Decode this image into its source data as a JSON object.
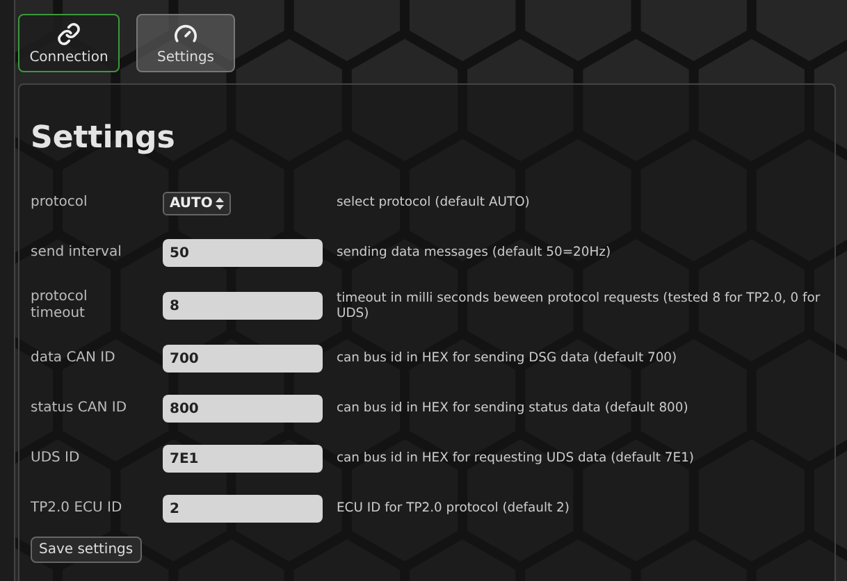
{
  "tabs": [
    {
      "label": "Connection",
      "selected": true
    },
    {
      "label": "Settings",
      "selected": false
    }
  ],
  "panel": {
    "title": "Settings",
    "fields": [
      {
        "kind": "select",
        "label": "protocol",
        "value": "AUTO",
        "description": "select protocol (default AUTO)"
      },
      {
        "kind": "input",
        "label": "send interval",
        "value": "50",
        "description": "sending data messages (default 50=20Hz)"
      },
      {
        "kind": "input",
        "label": "protocol timeout",
        "value": "8",
        "description": "timeout in milli seconds beween protocol requests (tested 8 for TP2.0, 0 for UDS)"
      },
      {
        "kind": "input",
        "label": "data CAN ID",
        "value": "700",
        "description": "can bus id in HEX for sending DSG data (default 700)"
      },
      {
        "kind": "input",
        "label": "status CAN ID",
        "value": "800",
        "description": "can bus id in HEX for sending status data (default 800)"
      },
      {
        "kind": "input",
        "label": "UDS ID",
        "value": "7E1",
        "description": "can bus id in HEX for requesting UDS data (default 7E1)"
      },
      {
        "kind": "input",
        "label": "TP2.0 ECU ID",
        "value": "2",
        "description": "ECU ID for TP2.0 protocol (default 2)"
      }
    ],
    "save_button": "Save settings"
  }
}
